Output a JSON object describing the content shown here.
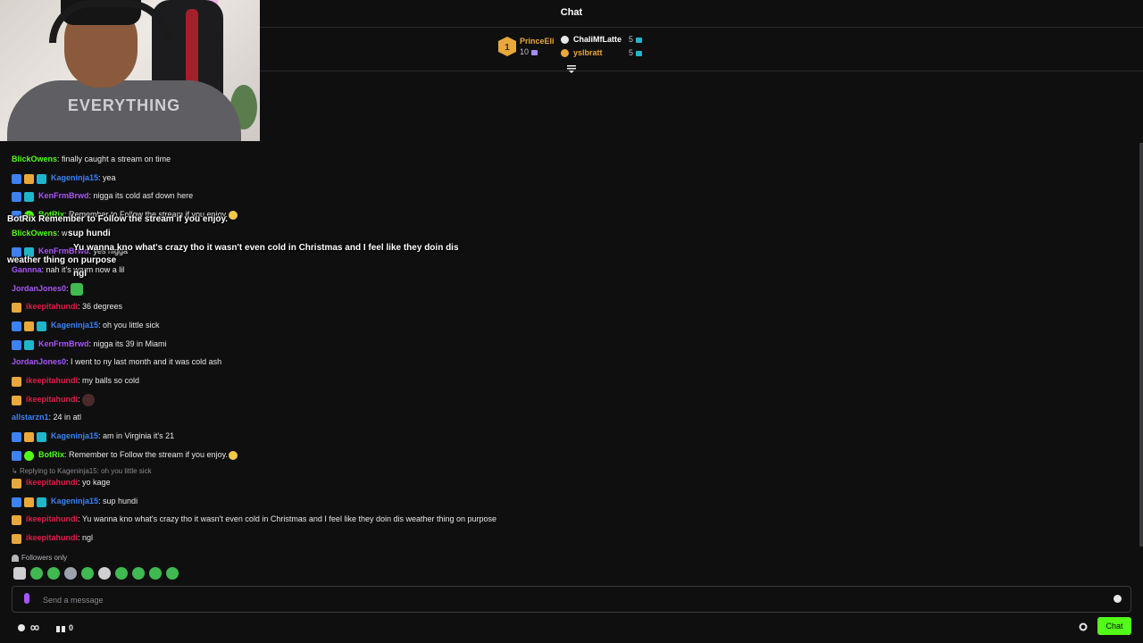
{
  "header": {
    "title": "Chat"
  },
  "leaderboard": {
    "first": {
      "rank": "1",
      "name": "PrinceEli",
      "count": "10"
    },
    "others": [
      {
        "name": "ChaliMfLatte",
        "count": "5",
        "color": "#ffffff"
      },
      {
        "name": "yslbratt",
        "count": "5",
        "color": "#e9a83a"
      }
    ]
  },
  "webcam": {
    "shirt_text": "EVERYTHING"
  },
  "messages": [
    {
      "user": "BlickOwens",
      "text": ": finally caught a stream on time",
      "color": "#53fc18",
      "badges": []
    },
    {
      "user": "Kageninja15",
      "text": ": yea",
      "color": "#3c82f6",
      "badges": [
        "b-blue",
        "b-crown",
        "b-teal"
      ]
    },
    {
      "user": "KenFrmBrwd",
      "text": ": nigga its cold asf down here",
      "color": "#a855f7",
      "badges": [
        "b-blue",
        "b-teal"
      ]
    },
    {
      "user": "BotRix",
      "text": ": Remember to Follow the stream if you enjoy.",
      "color": "#53fc18",
      "badges": [
        "b-blue",
        "b-green"
      ]
    },
    {
      "user": "BlickOwens",
      "text": ": w",
      "color": "#53fc18",
      "badges": []
    },
    {
      "user": "KenFrmBrwd",
      "text": ": yes nigga",
      "color": "#a855f7",
      "badges": [
        "b-blue",
        "b-teal"
      ]
    },
    {
      "user": "Gannna",
      "text": ": nah it's warm now a lil",
      "color": "#a855f7",
      "badges": []
    },
    {
      "user": "JordanJones0",
      "text": ":",
      "color": "#a855f7",
      "badges": []
    },
    {
      "user": "ikeepitahundi",
      "text": ": 36 degrees",
      "color": "#e11d48",
      "badges": [
        "b-crown"
      ]
    },
    {
      "user": "Kageninja15",
      "text": ": oh you little sick",
      "color": "#3c82f6",
      "badges": [
        "b-blue",
        "b-crown",
        "b-teal"
      ]
    },
    {
      "user": "KenFrmBrwd",
      "text": ": nigga its 39 in Miami",
      "color": "#a855f7",
      "badges": [
        "b-blue",
        "b-teal"
      ]
    },
    {
      "user": "JordanJones0",
      "text": ": I went to ny last month and it was cold ash",
      "color": "#a855f7",
      "badges": []
    },
    {
      "user": "ikeepitahundi",
      "text": ": my balls so cold",
      "color": "#e11d48",
      "badges": [
        "b-crown"
      ]
    },
    {
      "user": "ikeepitahundi",
      "text": ":",
      "color": "#e11d48",
      "badges": [
        "b-crown"
      ]
    },
    {
      "user": "allstarzn1",
      "text": ": 24 in atl",
      "color": "#3c82f6",
      "badges": []
    },
    {
      "user": "Kageninja15",
      "text": ": am in Virginia it's 21",
      "color": "#3c82f6",
      "badges": [
        "b-blue",
        "b-crown",
        "b-teal"
      ]
    },
    {
      "user": "BotRix",
      "text": ": Remember to Follow the stream if you enjoy.",
      "color": "#53fc18",
      "badges": [
        "b-blue",
        "b-green"
      ]
    },
    {
      "user": "ikeepitahundi",
      "text": ": yo kage",
      "color": "#e11d48",
      "badges": [
        "b-crown"
      ]
    },
    {
      "user": "Kageninja15",
      "text": ": sup hundi",
      "color": "#3c82f6",
      "badges": [
        "b-blue",
        "b-crown",
        "b-teal"
      ]
    },
    {
      "user": "ikeepitahundi",
      "text": ": Yu wanna kno what's crazy tho it wasn't even cold in Christmas and I feel like they doin dis weather thing on purpose",
      "color": "#e11d48",
      "badges": [
        "b-crown"
      ]
    },
    {
      "user": "ikeepitahundi",
      "text": ": ngl",
      "color": "#e11d48",
      "badges": [
        "b-crown"
      ]
    }
  ],
  "reply_text": "Replying to Kageninja15: oh you little sick",
  "overlay": [
    "BotRix  Remember to Follow the stream if you enjoy.",
    "sup hundi",
    "Yu wanna kno what's crazy tho it wasn't even cold in Christmas and I feel like they doin dis",
    "weather thing on purpose",
    "ngl"
  ],
  "followers_only": "Followers only",
  "input": {
    "placeholder": "Send a message"
  },
  "footer": {
    "count": "0",
    "chat_button": "Chat"
  },
  "colors": {
    "accent": "#53fc18",
    "background": "#0f0f10"
  }
}
